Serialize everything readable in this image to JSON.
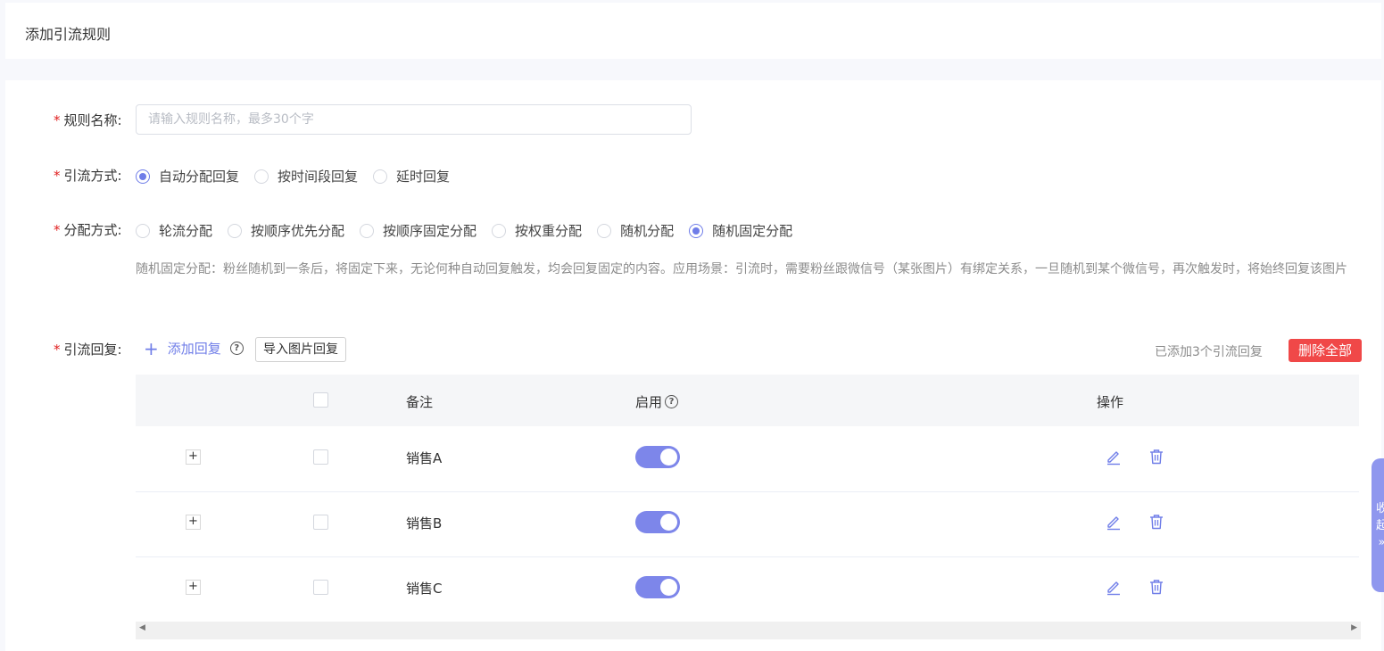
{
  "header": {
    "title": "添加引流规则"
  },
  "form": {
    "rule_name": {
      "label": "规则名称:",
      "placeholder": "请输入规则名称，最多30个字",
      "value": ""
    },
    "method": {
      "label": "引流方式:",
      "options": [
        "自动分配回复",
        "按时间段回复",
        "延时回复"
      ],
      "selected": "自动分配回复"
    },
    "distribution": {
      "label": "分配方式:",
      "options": [
        "轮流分配",
        "按顺序优先分配",
        "按顺序固定分配",
        "按权重分配",
        "随机分配",
        "随机固定分配"
      ],
      "selected": "随机固定分配",
      "description": "随机固定分配：粉丝随机到一条后，将固定下来，无论何种自动回复触发，均会回复固定的内容。应用场景：引流时，需要粉丝跟微信号（某张图片）有绑定关系，一旦随机到某个微信号，再次触发时，将始终回复该图片"
    },
    "replies": {
      "label": "引流回复:",
      "add_label": "添加回复",
      "import_label": "导入图片回复",
      "count_text": "已添加3个引流回复",
      "delete_all_label": "删除全部"
    }
  },
  "table": {
    "columns": {
      "note": "备注",
      "enabled": "启用",
      "actions": "操作"
    },
    "rows": [
      {
        "expand": "+",
        "note": "销售A",
        "enabled": true
      },
      {
        "expand": "+",
        "note": "销售B",
        "enabled": true
      },
      {
        "expand": "+",
        "note": "销售C",
        "enabled": true
      }
    ]
  },
  "side_tab": {
    "line1": "收",
    "line2": "起",
    "line3": "»"
  },
  "icons": {
    "help": "question-circle-icon",
    "add": "plus-icon",
    "edit": "edit-icon",
    "delete": "trash-icon"
  },
  "colors": {
    "accent": "#6f7de8",
    "danger": "#f04848",
    "switch_on": "#7d86ea"
  }
}
